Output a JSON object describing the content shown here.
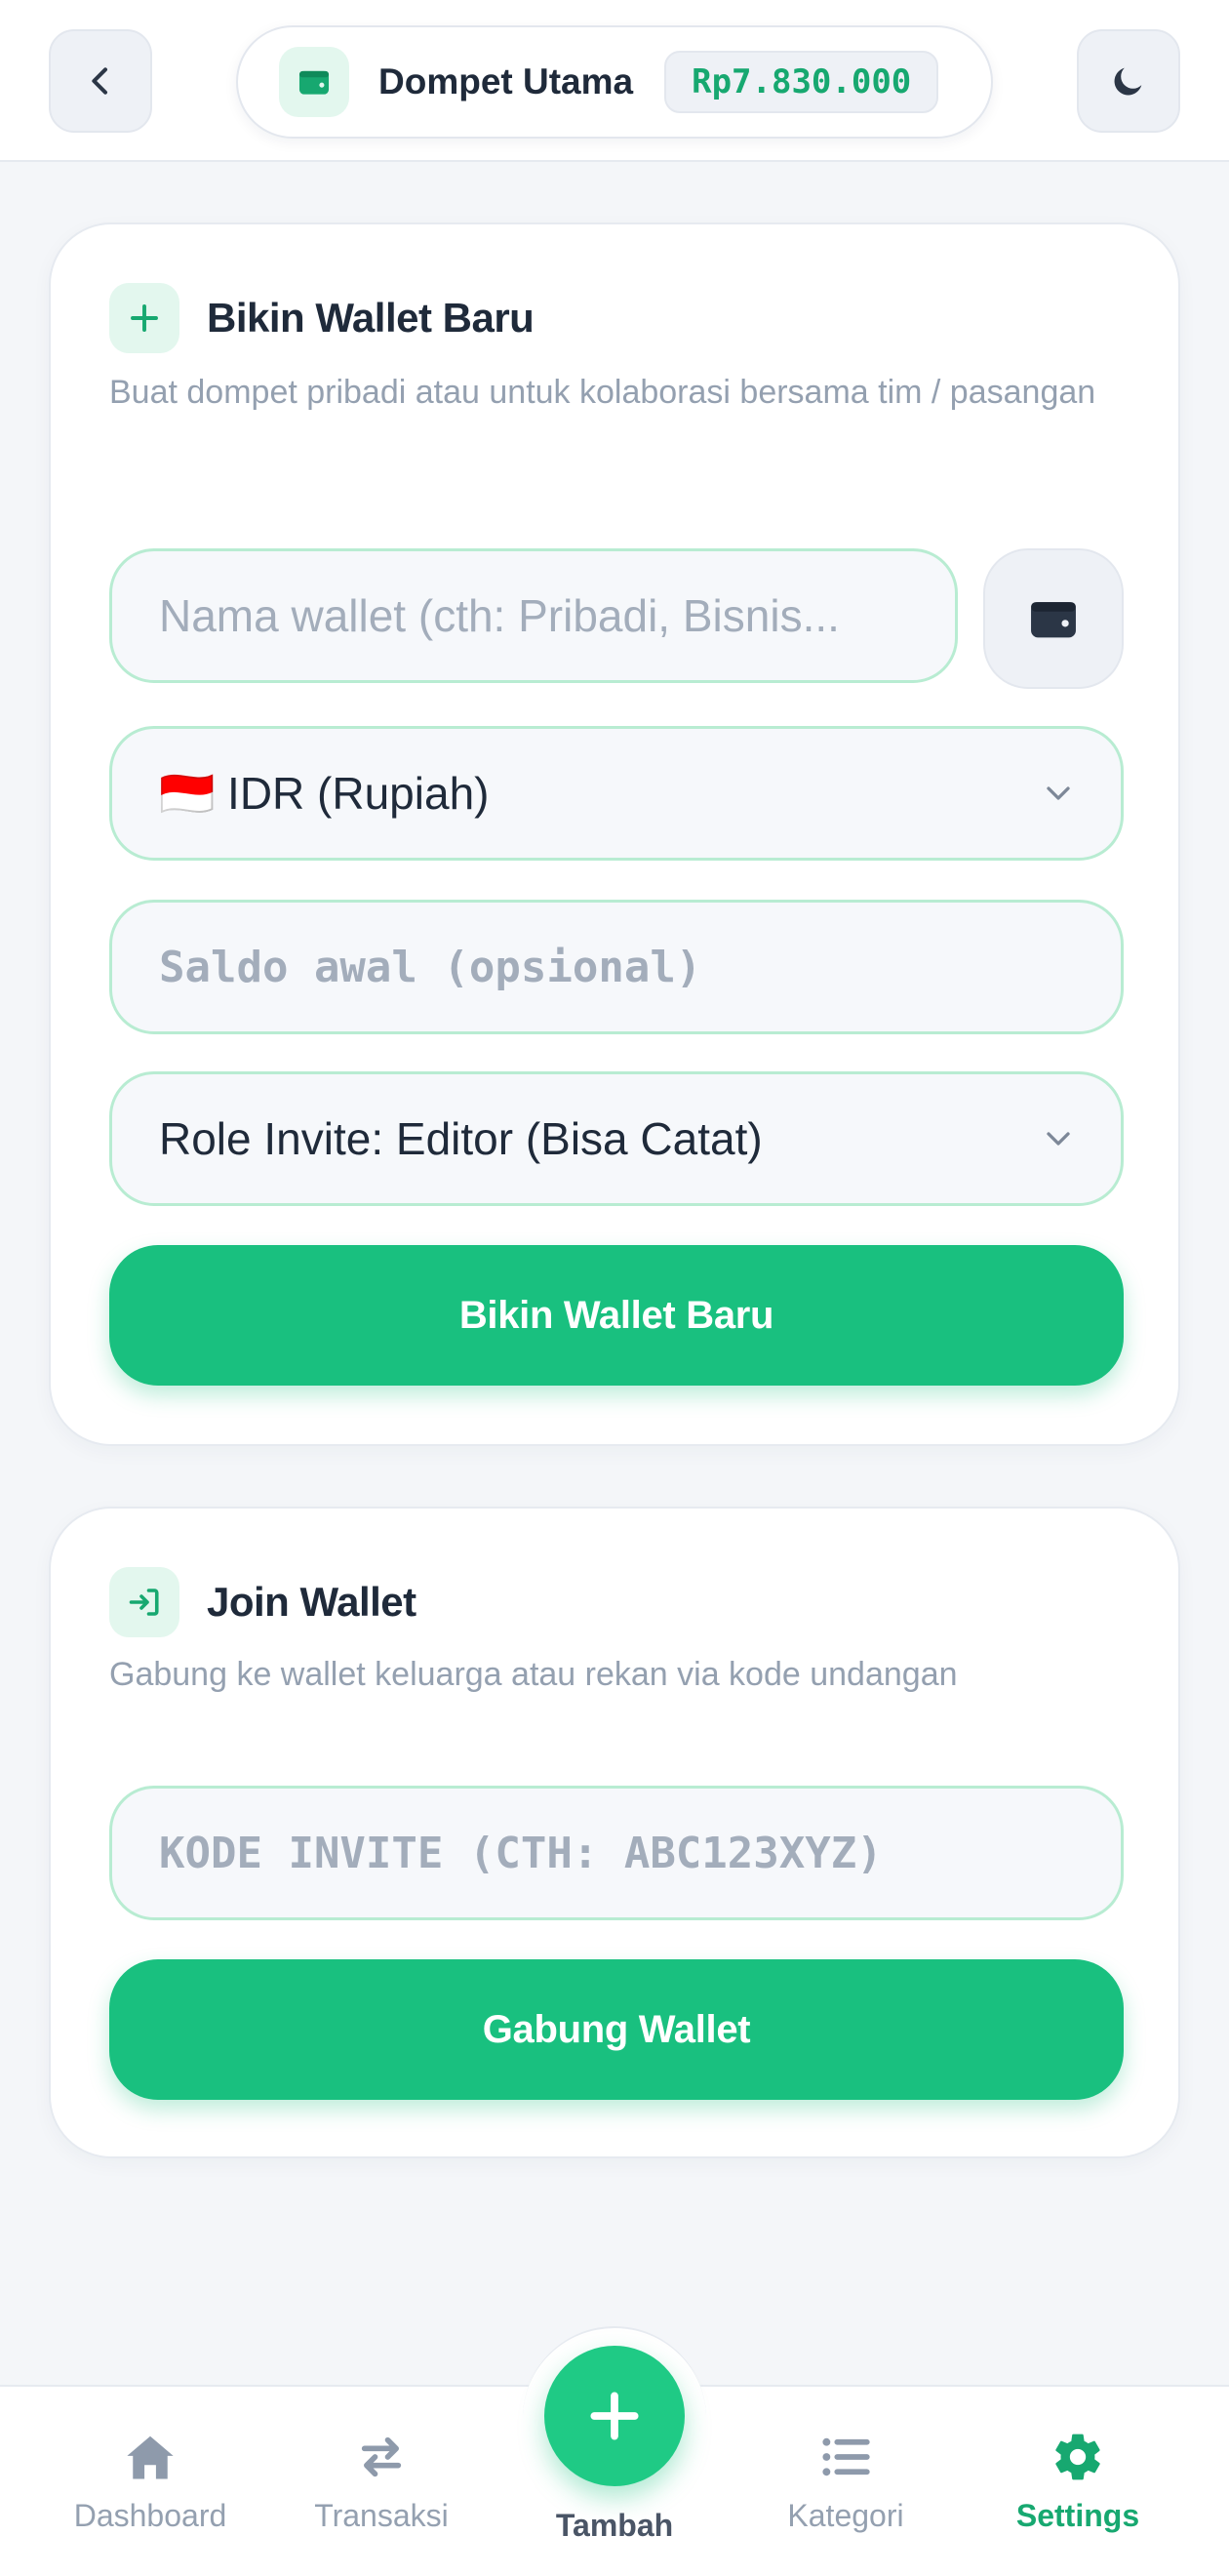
{
  "header": {
    "wallet_name": "Dompet Utama",
    "wallet_balance": "Rp7.830.000",
    "back_icon": "chevron-left-icon",
    "theme_icon": "moon-icon",
    "wallet_icon": "wallet-icon"
  },
  "create_wallet": {
    "title": "Bikin Wallet Baru",
    "description": "Buat dompet pribadi atau untuk kolaborasi bersama tim / pasangan",
    "name_placeholder": "Nama wallet (cth: Pribadi, Bisnis...",
    "name_value": "",
    "currency_selected": "🇮🇩 IDR (Rupiah)",
    "saldo_placeholder": "Saldo awal (opsional)",
    "saldo_value": "",
    "role_selected": "Role Invite: Editor (Bisa Catat)",
    "submit_label": "Bikin Wallet Baru"
  },
  "join_wallet": {
    "title": "Join Wallet",
    "description": "Gabung ke wallet keluarga atau rekan via kode undangan",
    "code_placeholder": "KODE INVITE (CTH: ABC123XYZ)",
    "code_value": "",
    "submit_label": "Gabung Wallet"
  },
  "bottom_nav": {
    "items": [
      {
        "label": "Dashboard",
        "icon": "home-icon",
        "active": false
      },
      {
        "label": "Transaksi",
        "icon": "swap-arrows-icon",
        "active": false
      },
      {
        "label": "Tambah",
        "icon": "plus-icon",
        "active": false
      },
      {
        "label": "Kategori",
        "icon": "list-icon",
        "active": false
      },
      {
        "label": "Settings",
        "icon": "gear-icon",
        "active": true
      }
    ]
  },
  "colors": {
    "accent": "#19c07f",
    "accent_text": "#17a870",
    "background": "#f4f6f9",
    "muted_text": "#94a0b0",
    "input_border": "#b8ecd2"
  }
}
